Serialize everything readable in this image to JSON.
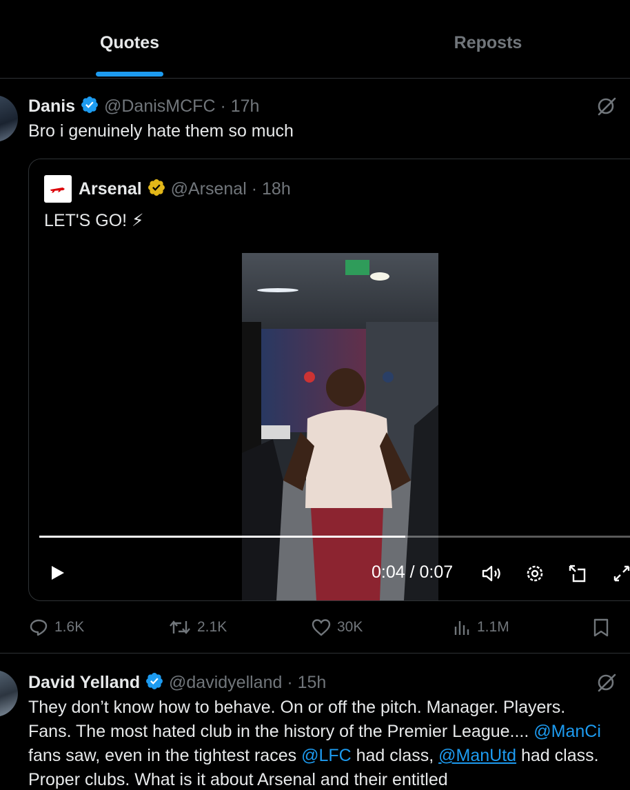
{
  "tabs": {
    "quotes": "Quotes",
    "reposts": "Reposts"
  },
  "post1": {
    "name": "Danis",
    "handle": "@DanisMCFC",
    "time": "· 17h",
    "text": "Bro i genuinely hate them so much",
    "quoted": {
      "name": "Arsenal",
      "handle": "@Arsenal",
      "time": "· 18h",
      "text": "LET'S GO! ⚡",
      "video": {
        "current_time": "0:04",
        "duration": "0:07",
        "time_display": "0:04 / 0:07",
        "progress": 0.6
      }
    },
    "stats": {
      "replies": "1.6K",
      "reposts": "2.1K",
      "likes": "30K",
      "views": "1.1M"
    }
  },
  "post2": {
    "name": "David Yelland",
    "handle": "@davidyelland",
    "time": "· 15h",
    "line1": "They don’t know how to behave. On or off the pitch. Manager. Players.",
    "line2_a": "Fans. The most hated club in the history of the Premier League.... ",
    "line2_mention": "@ManCi",
    "line3_a": "fans saw, even in the tightest races ",
    "line3_m1": "@LFC",
    "line3_b": " had class, ",
    "line3_m2": "@ManUtd",
    "line3_c": " had class.",
    "line4": "Proper clubs. What is it about Arsenal and their entitled"
  },
  "colors": {
    "accent": "#1d9bf0",
    "verified": "#1d9bf0",
    "gold_verified": "#e2b719",
    "muted": "#71767b",
    "border": "#2f3336"
  },
  "icons": [
    "verified-badge-icon",
    "grok-icon",
    "play-icon",
    "volume-icon",
    "settings-icon",
    "popout-icon",
    "fullscreen-icon",
    "reply-icon",
    "repost-icon",
    "like-icon",
    "views-icon",
    "bookmark-icon"
  ]
}
